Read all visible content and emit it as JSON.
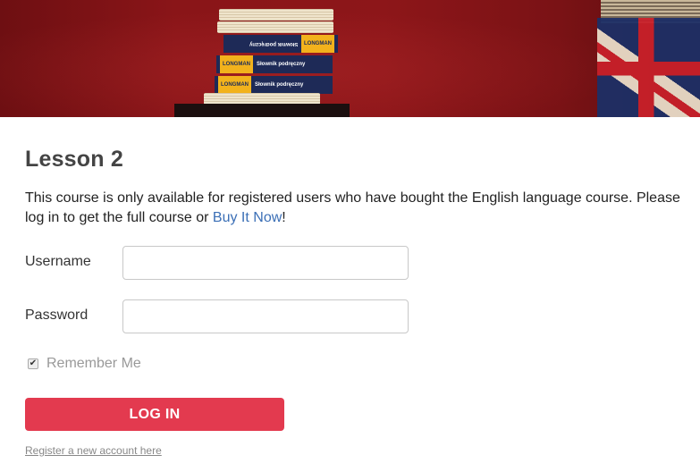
{
  "banner": {
    "book_labels": [
      "LONGMAN",
      "Słownik podręczny",
      "LONGMAN",
      "Słownik podręczny",
      "LONGMAN",
      "Słownik podręczny"
    ]
  },
  "lesson": {
    "title": "Lesson 2",
    "intro_text": "This course is only available for registered users who have bought the English language course. Please log in to get the full course or ",
    "buy_link": "Buy It Now",
    "intro_end": "!"
  },
  "login_form": {
    "username_label": "Username",
    "password_label": "Password",
    "username_value": "",
    "password_value": "",
    "remember_me_label": "Remember Me",
    "remember_me_checked": true,
    "login_button": "LOG IN",
    "register_link": "Register a new account here"
  },
  "colors": {
    "accent_button": "#e33a4f",
    "link": "#3b6fb6",
    "banner_red": "#8d1619"
  }
}
